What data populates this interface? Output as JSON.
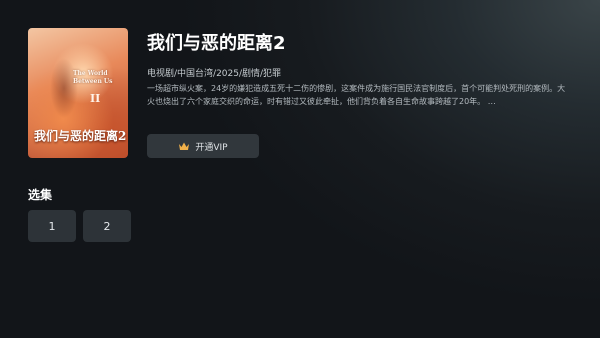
{
  "show": {
    "title": "我们与恶的距离2",
    "meta": "电视剧/中国台湾/2025/剧情/犯罪",
    "description": "一场超市纵火案，24岁的嫌犯造成五死十二伤的惨剧，这案件成为施行国民法官制度后，首个可能判处死刑的案例。大火也烧出了六个家庭交织的命运，时有错过又彼此牵扯，他们背负着各自生命故事跨越了20年。 …",
    "poster": {
      "english_title": "The World Between Us",
      "season_numeral": "II",
      "chinese_title": "我们与恶的距离2"
    }
  },
  "actions": {
    "vip_label": "开通VIP",
    "vip_icon": "crown-icon",
    "vip_icon_color": "#f0b04a"
  },
  "episodes": {
    "section_title": "选集",
    "items": [
      "1",
      "2"
    ]
  }
}
